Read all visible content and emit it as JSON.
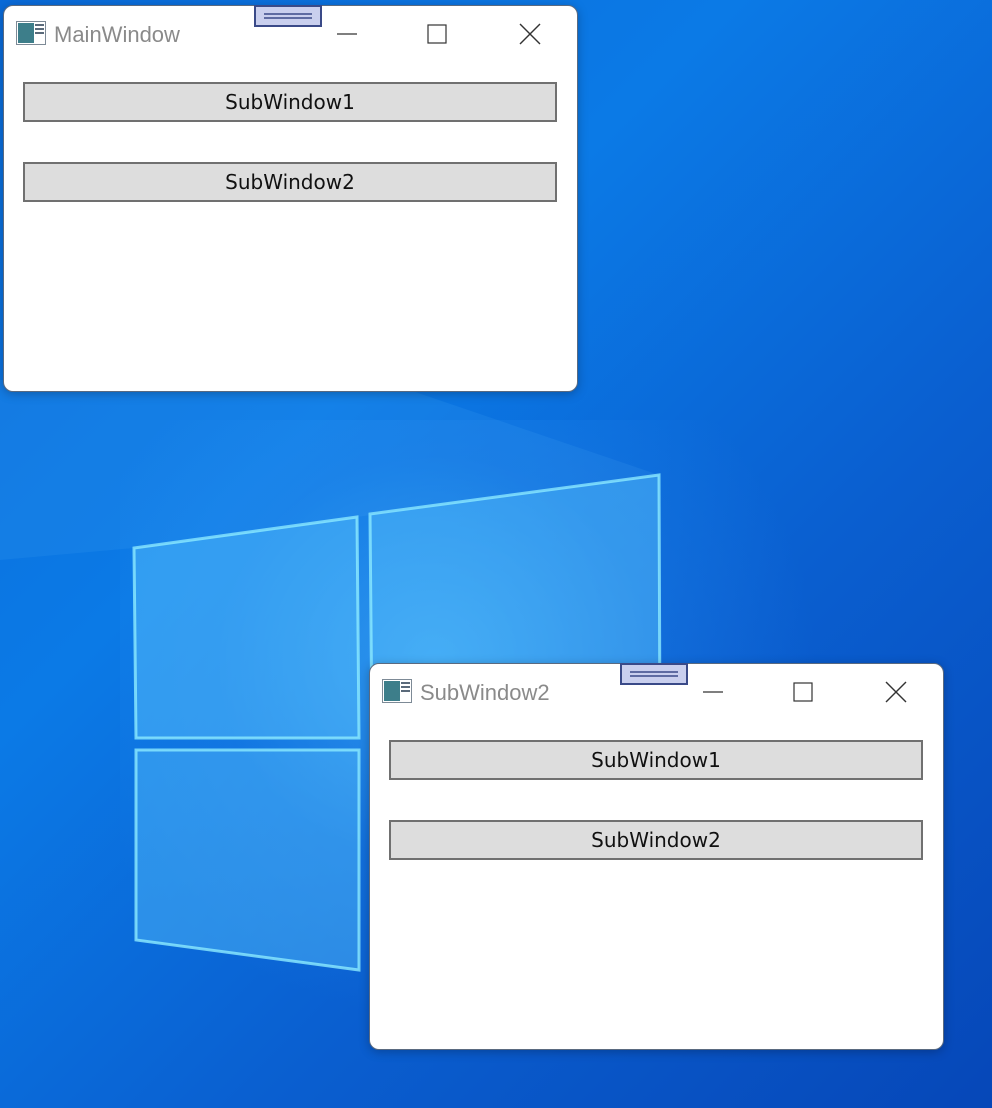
{
  "main_window": {
    "title": "MainWindow",
    "buttons": [
      {
        "label": "SubWindow1"
      },
      {
        "label": "SubWindow2"
      }
    ]
  },
  "sub_window": {
    "title": "SubWindow2",
    "buttons": [
      {
        "label": "SubWindow1"
      },
      {
        "label": "SubWindow2"
      }
    ]
  },
  "colors": {
    "desktop_background": "#0a6ad8",
    "button_face": "#dddddd",
    "grip_fill": "#c9cfee",
    "title_text": "#8a8a8a"
  },
  "icons": {
    "window_controls": [
      "minimize-icon",
      "maximize-icon",
      "close-icon"
    ],
    "app_icon": "app-window-icon",
    "grip": "drag-grip-icon"
  }
}
